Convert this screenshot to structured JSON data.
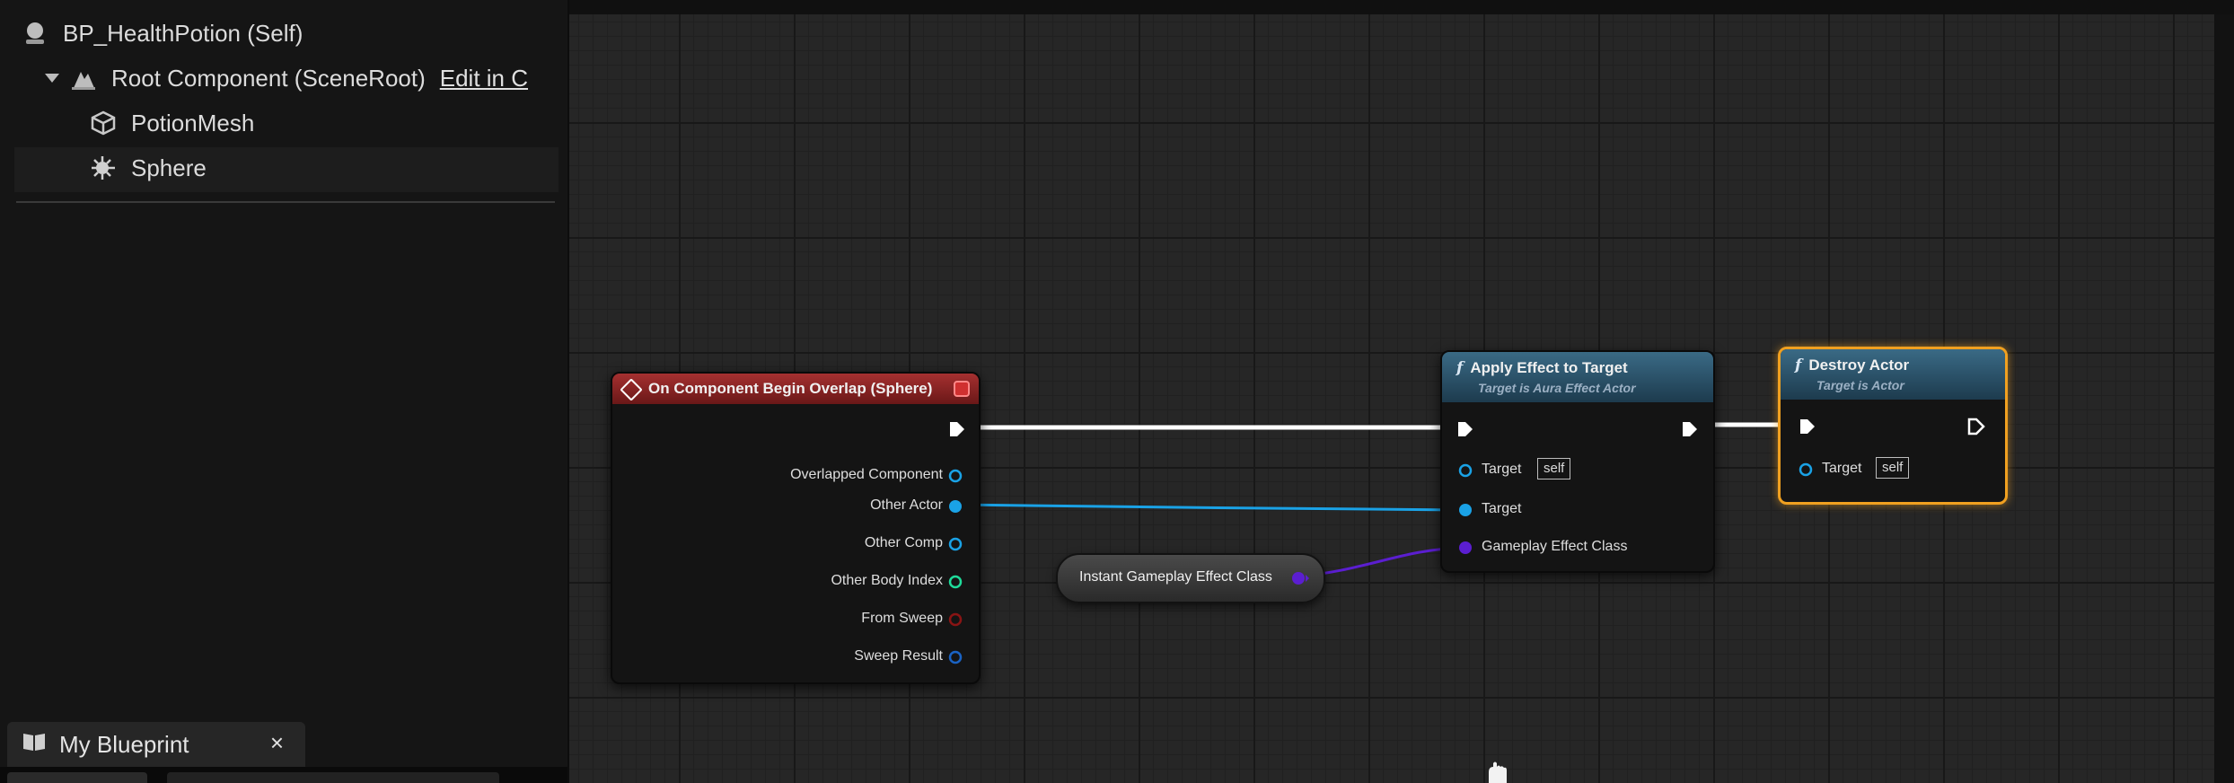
{
  "components_panel": {
    "self_label": "BP_HealthPotion (Self)",
    "root_label": "Root Component (SceneRoot)",
    "root_edit_link": "Edit in C",
    "children": [
      {
        "label": "PotionMesh",
        "icon": "static-mesh-icon"
      },
      {
        "label": "Sphere",
        "icon": "sphere-collision-icon"
      }
    ]
  },
  "bottom_tab": {
    "label": "My Blueprint",
    "close": "×",
    "icon": "book-icon"
  },
  "graph": {
    "event_node": {
      "title": "On Component Begin Overlap (Sphere)",
      "pins": [
        "Overlapped Component",
        "Other Actor",
        "Other Comp",
        "Other Body Index",
        "From Sweep",
        "Sweep Result"
      ]
    },
    "apply_node": {
      "title": "Apply Effect to Target",
      "subtitle": "Target is Aura Effect Actor",
      "pins": [
        {
          "label": "Target",
          "default": "self"
        },
        {
          "label": "Target"
        },
        {
          "label": "Gameplay Effect Class"
        }
      ]
    },
    "destroy_node": {
      "title": "Destroy Actor",
      "subtitle": "Target is Actor",
      "pins": [
        {
          "label": "Target",
          "default": "self"
        }
      ]
    },
    "variable_node": {
      "label": "Instant Gameplay Effect Class"
    },
    "colors": {
      "exec": "#ffffff",
      "object": "#1aa2e6",
      "class": "#5b1ed0",
      "int": "#1fdb9a",
      "bool": "#8a1414",
      "struct": "#1a63c4",
      "selected": "#f0a020",
      "event_header": "#a53030",
      "function_header": "#3a6a85"
    }
  }
}
